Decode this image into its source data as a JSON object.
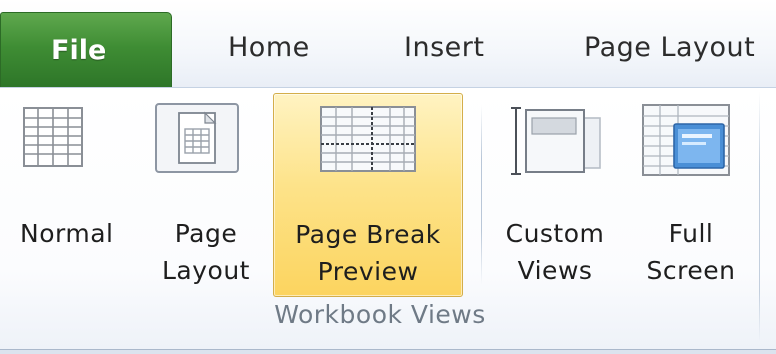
{
  "tabs": {
    "file": "File",
    "home": "Home",
    "insert": "Insert",
    "page_layout": "Page Layout"
  },
  "group": {
    "label": "Workbook Views"
  },
  "buttons": {
    "normal": {
      "line1": "Normal",
      "line2": "",
      "icon": "normal-view-icon"
    },
    "page_layout": {
      "line1": "Page",
      "line2": "Layout",
      "icon": "page-layout-view-icon"
    },
    "page_break_preview": {
      "line1": "Page Break",
      "line2": "Preview",
      "icon": "page-break-preview-icon",
      "selected": true
    },
    "custom_views": {
      "line1": "Custom",
      "line2": "Views",
      "icon": "custom-views-icon"
    },
    "full_screen": {
      "line1": "Full",
      "line2": "Screen",
      "icon": "full-screen-icon"
    }
  },
  "colors": {
    "file_tab": "#3f8d34",
    "selected_button": "#fde38a",
    "group_label": "#6f7a86"
  }
}
